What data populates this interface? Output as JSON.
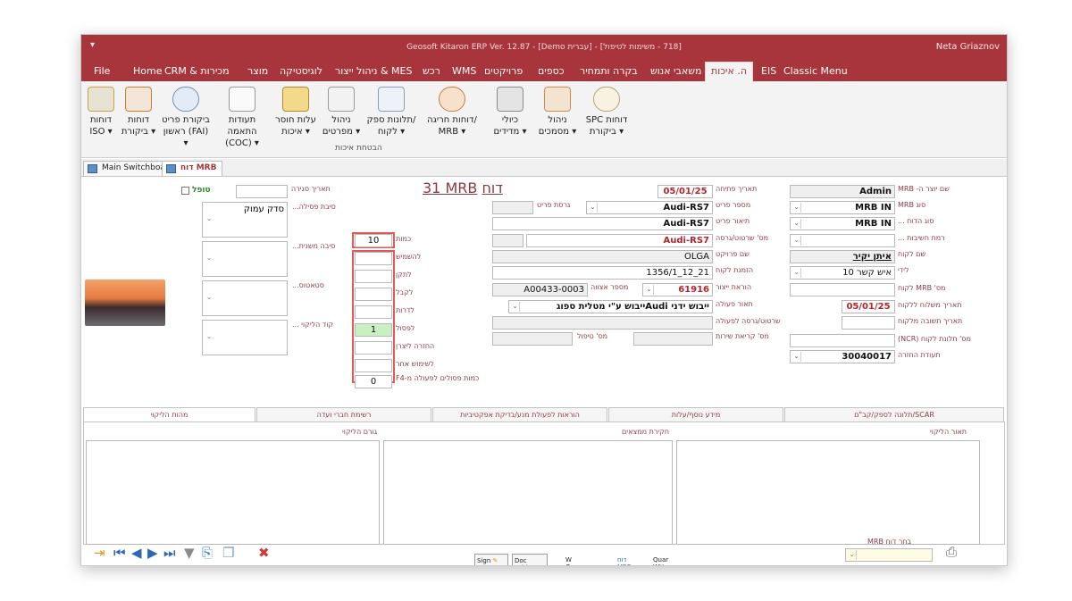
{
  "titlebar": {
    "title": "Geosoft Kitaron ERP Ver. 12.87 - [Demo עברית] - [718 - משימות לטיפול]",
    "user": "Neta Griaznov"
  },
  "ribbon_tabs": [
    "File",
    "Home",
    "CRM & מכירות",
    "מוצר",
    "לוגיסטיקה",
    "ניהול ייצור & MES",
    "רכש",
    "WMS",
    "פרויקטים",
    "כספים",
    "בקרה ותמחיר",
    "משאבי אנוש",
    "ה. איכות",
    "EIS",
    "Classic Menu"
  ],
  "ribbon_active": "ה. איכות",
  "ribbon_buttons": [
    {
      "l1": "דוחות",
      "l2": "ISO ▾"
    },
    {
      "l1": "דוחות",
      "l2": "ביקורת ▾"
    },
    {
      "l1": "ביקורת פריט",
      "l2": "ראשון (FAI) ▾"
    },
    {
      "l1": "תעודות התאמה",
      "l2": "(COC) ▾"
    },
    {
      "l1": "עלות חוסר",
      "l2": "איכות ▾"
    },
    {
      "l1": "ניהול",
      "l2": "מפרטים ▾"
    },
    {
      "l1": "תלונות ספק/",
      "l2": "לקוח ▾"
    },
    {
      "l1": "דוחות חריגה/",
      "l2": "MRB ▾"
    },
    {
      "l1": "כיולי",
      "l2": "מדידים ▾"
    },
    {
      "l1": "ניהול",
      "l2": "מסמכים ▾"
    },
    {
      "l1": "SPC דוחות",
      "l2": "ביקורת ▾"
    }
  ],
  "ribbon_group": "הבטחת איכות",
  "doc_tabs": [
    "Main Switchboard",
    "דוח MRB"
  ],
  "form": {
    "title": "דוח",
    "title_code": "31 MRB",
    "labels": {
      "closed": "טופל",
      "close_date": "תאריך סגירה",
      "reject_reason": "סיבת פסילה...",
      "reject_reason_value": "סדק עמוק",
      "secondary_reason": "סיבה משנית...",
      "status": "סטאטוס...",
      "reject_code": "קוד הליקוי ...",
      "qty": "כמות",
      "use_as_is": "להשמיש",
      "repair": "לתקן",
      "accept": "לקבל",
      "downgrade": "לדרות",
      "scrap": "לפסול",
      "return_supplier": "החזרה ליצרן",
      "other_use": "לשימוש אחר",
      "f4_rejects": "כמות פסולים לפעולה מ-F4",
      "part_version": "גרסת פריט",
      "assembly_no": "מספר אצווה",
      "treat_no": "מס' טיפול",
      "open_date": "תאריך פתיחה",
      "part_no": "מספר פריט",
      "part_desc": "תיאור פריט",
      "drawing_no": "מס' שרטוט/גרסה",
      "project": "שם פרויקט",
      "cust_order": "הזמנת לקוח",
      "prod_order": "הוראת ייצור",
      "op_desc": "תאור פעולה",
      "op_drawing": "שרטוט/גרסה לפעולה",
      "service_call": "מס' קריאת שירות",
      "created_by": "שם יוצר ה- MRB",
      "mrb_type": "סוג MRB",
      "report_type": "סוג הדוח ...",
      "importance": "רמת חשיבות ...",
      "customer_name": "שם לקוח",
      "contact": "לידי",
      "cust_mrb": "מס' MRB לקוח",
      "send_date": "תאריך משלוח ללקוח",
      "reply_date": "תאריך תשובה מלקוח",
      "ncr_no": "מס' תלונת לקוח (NCR)",
      "return_cert": "תעודת החזרה"
    },
    "values": {
      "qty": "10",
      "scrap": "1",
      "f4_rejects": "0",
      "assembly_no": "A00433-0003",
      "open_date": "05/01/25",
      "part_no": "Audi-RS7",
      "part_desc": "Audi-RS7",
      "drawing_no": "Audi-RS7",
      "project": "OLGA",
      "cust_order": "21_12_1356/1",
      "prod_order": "61916",
      "op_desc": "ייבוש ידני Audiייבוש ע\"י מטלית ספוג",
      "created_by": "Admin",
      "mrb_type": "MRB IN",
      "report_type": "MRB IN",
      "customer_name": "איתן יקיר",
      "contact": "איש קשר 10",
      "send_date": "05/01/25",
      "return_cert": "30040017"
    }
  },
  "lower_tabs": [
    "תלונה לספק/קב\"ם/SCAR",
    "מידע נוסף/עלות",
    "הוראות לפעולת מנע/בדיקת אפקטיביות",
    "רשימת חברי ועדה",
    "מהות הליקוי"
  ],
  "panels": {
    "right": "תאור הליקוי",
    "middle": "חקירת ממצאים",
    "left": "גורם הליקוי"
  },
  "bottom": {
    "sign": "Sign",
    "doc_fold": "Doc\nFold",
    "wo": "W\nO",
    "mrb": "דוח\nMRB",
    "quar": "Quar\nWH",
    "select_mrb": "בחר דוח MRB"
  },
  "colors": {
    "brand": "#a8353b",
    "label": "#8b3a3f",
    "ok": "#c8f0c0",
    "highlight": "#e05a5a"
  }
}
